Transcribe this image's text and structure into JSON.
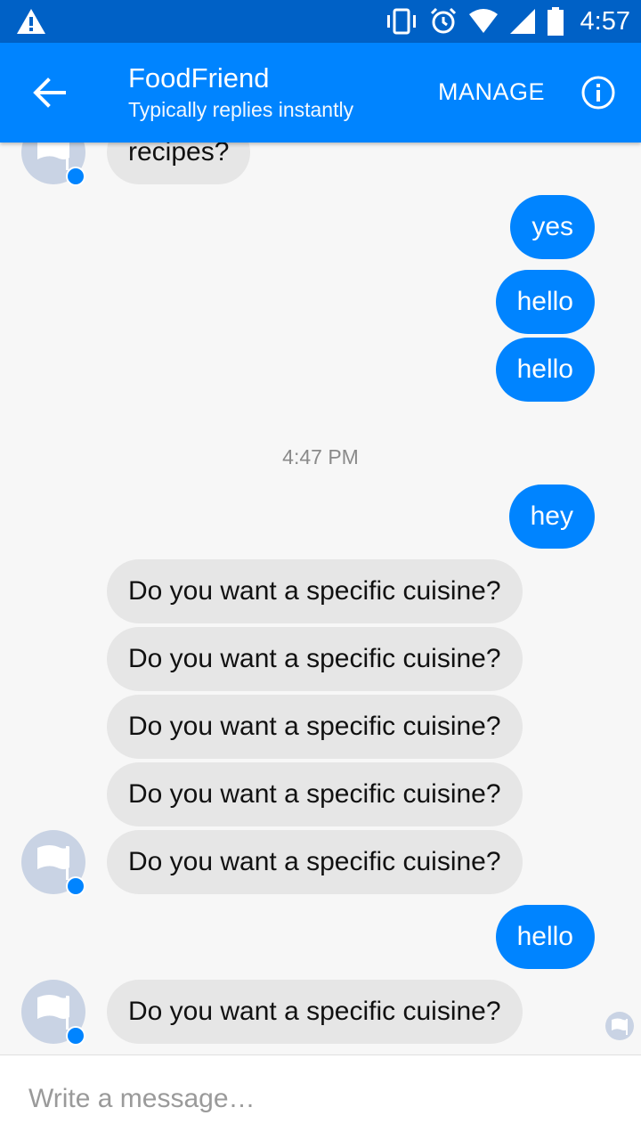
{
  "status_bar": {
    "time": "4:57"
  },
  "header": {
    "title": "FoodFriend",
    "subtitle": "Typically replies instantly",
    "manage_label": "MANAGE"
  },
  "messages": [
    {
      "from": "bot",
      "text": "recipes?"
    },
    {
      "from": "me",
      "text": "yes"
    },
    {
      "from": "me",
      "text": "hello"
    },
    {
      "from": "me",
      "text": "hello"
    },
    {
      "from": "me",
      "text": "hey"
    },
    {
      "from": "bot",
      "text": "Do you want a specific cuisine?"
    },
    {
      "from": "bot",
      "text": "Do you want a specific cuisine?"
    },
    {
      "from": "bot",
      "text": "Do you want a specific cuisine?"
    },
    {
      "from": "bot",
      "text": "Do you want a specific cuisine?"
    },
    {
      "from": "bot",
      "text": "Do you want a specific cuisine?"
    },
    {
      "from": "me",
      "text": "hello"
    },
    {
      "from": "bot",
      "text": "Do you want a specific cuisine?"
    }
  ],
  "timestamp": "4:47 PM",
  "composer": {
    "placeholder": "Write a message…"
  },
  "colors": {
    "status_bar": "#0061c6",
    "app_bar": "#0084ff",
    "my_bubble": "#0084ff",
    "bot_bubble": "#e6e6e6"
  }
}
